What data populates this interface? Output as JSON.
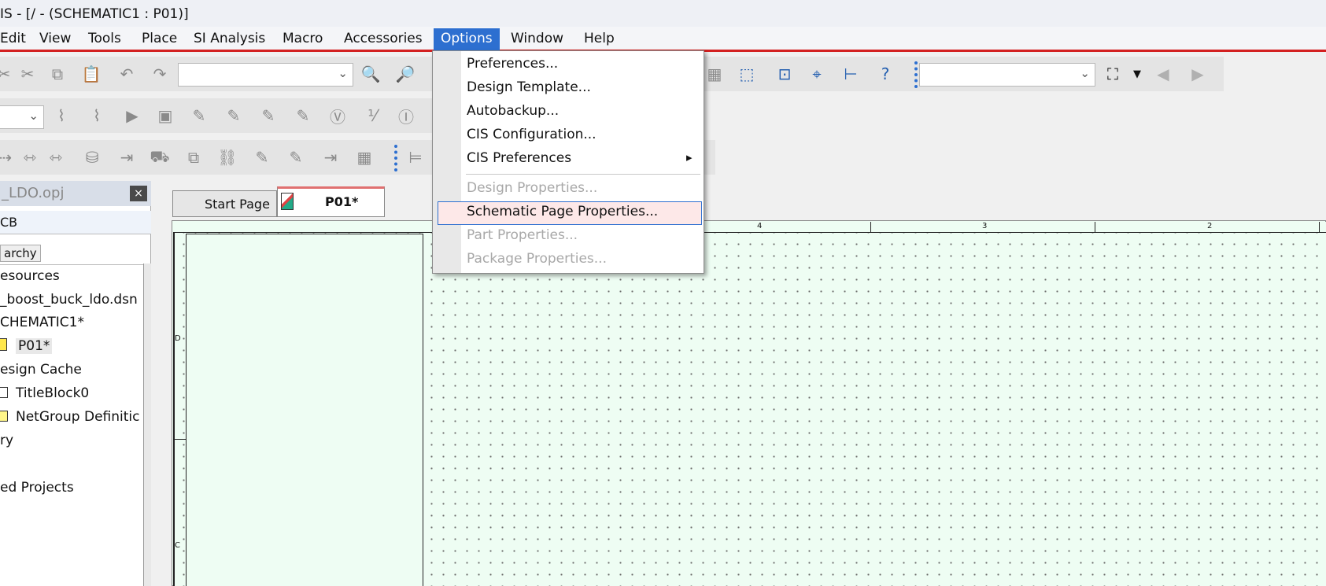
{
  "window": {
    "title": "IS - [/ - (SCHEMATIC1 : P01)]"
  },
  "menubar": {
    "items": [
      {
        "label": "Edit",
        "active": false
      },
      {
        "label": "View",
        "active": false
      },
      {
        "label": "Tools",
        "active": false
      },
      {
        "label": "Place",
        "active": false
      },
      {
        "label": "SI Analysis",
        "active": false
      },
      {
        "label": "Macro",
        "active": false
      },
      {
        "label": "Accessories",
        "active": false
      },
      {
        "label": "Options",
        "active": true
      },
      {
        "label": "Window",
        "active": false
      },
      {
        "label": "Help",
        "active": false
      }
    ]
  },
  "options_menu": {
    "items": [
      {
        "label": "Preferences...",
        "enabled": true
      },
      {
        "label": "Design Template...",
        "enabled": true
      },
      {
        "label": "Autobackup...",
        "enabled": true
      },
      {
        "label": "CIS Configuration...",
        "enabled": true
      },
      {
        "label": "CIS Preferences",
        "enabled": true,
        "submenu": true
      },
      {
        "label": "Design Properties...",
        "enabled": false
      },
      {
        "label": "Schematic Page Properties...",
        "enabled": true,
        "highlighted": true
      },
      {
        "label": "Part Properties...",
        "enabled": false
      },
      {
        "label": "Package Properties...",
        "enabled": false
      }
    ],
    "submenu_arrow": "▸"
  },
  "project_panel": {
    "title": "_LDO.opj",
    "close_label": "×",
    "tab_label": "CB",
    "view_tab": "archy",
    "tree": [
      "esources",
      "_boost_buck_ldo.dsn",
      "CHEMATIC1*",
      "P01*",
      "esign Cache",
      "TitleBlock0",
      "NetGroup Definitic",
      "ry",
      "ed Projects"
    ]
  },
  "doc_tabs": {
    "start_page": "Start Page",
    "active": "P01*"
  },
  "ruler": {
    "labels": [
      "4",
      "3",
      "2"
    ],
    "left_marks": [
      "D",
      "C"
    ]
  },
  "icons": {
    "zoom_in": "zoom-in-icon",
    "zoom_out": "zoom-out-icon",
    "help": "help-icon",
    "find": "binoculars-icon"
  },
  "colors": {
    "accent": "#2d6fd0",
    "menu_underline": "#d32020",
    "canvas": "#eefdf3",
    "highlight": "#fde8e8"
  }
}
